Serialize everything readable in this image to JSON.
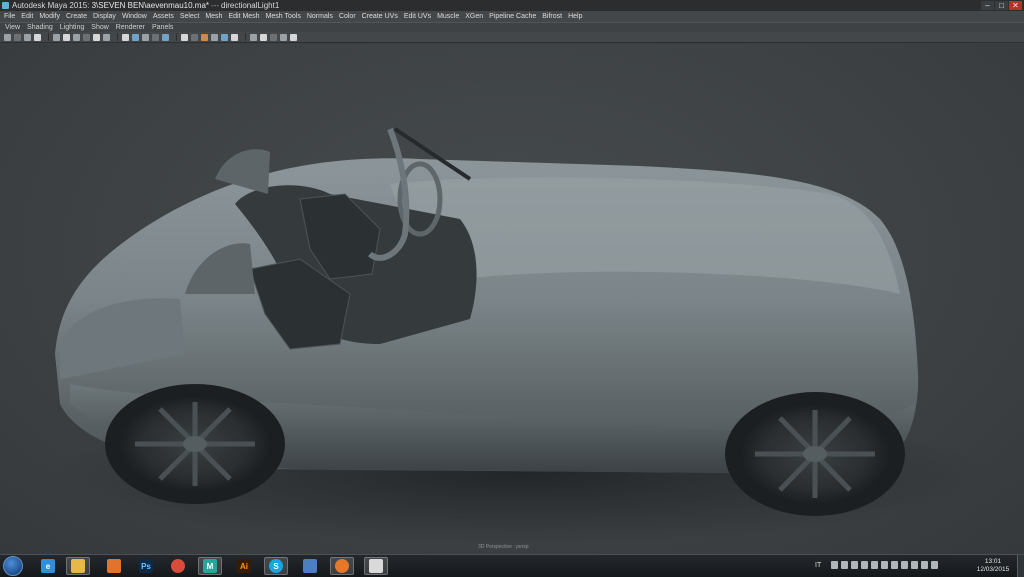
{
  "window": {
    "app_title": "Autodesk Maya 2015: ",
    "file_path": "3\\SEVEN BEN\\aevenmau10.ma*",
    "separator": "---",
    "selection": "directionalLight1",
    "controls": [
      "–",
      "□",
      "✕"
    ]
  },
  "menu": [
    "File",
    "Edit",
    "Modify",
    "Create",
    "Display",
    "Window",
    "Assets",
    "Select",
    "Mesh",
    "Edit Mesh",
    "Mesh Tools",
    "Normals",
    "Color",
    "Create UVs",
    "Edit UVs",
    "Muscle",
    "XGen",
    "Pipeline Cache",
    "Bifrost",
    "Help"
  ],
  "panel_menu": [
    "View",
    "Shading",
    "Lighting",
    "Show",
    "Renderer",
    "Panels"
  ],
  "toolbar_icons": [
    "camera-select-icon",
    "camera-lock-icon",
    "bookmark-icon",
    "image-plane-icon",
    "grid-icon",
    "film-gate-icon",
    "resolution-gate-icon",
    "gate-mask-icon",
    "field-chart-icon",
    "safe-action-icon",
    "wireframe-icon",
    "smooth-shade-icon",
    "flat-shade-icon",
    "bounding-box-icon",
    "textured-icon",
    "lights-icon",
    "shadows-icon",
    "ambient-occlusion-icon",
    "motion-blur-icon",
    "anti-alias-icon",
    "depth-of-field-icon",
    "isolate-select-icon",
    "xray-icon",
    "xray-joints-icon",
    "backface-icon",
    "gamma-icon"
  ],
  "viewport": {
    "camera_label": "3D Perspective : persp",
    "background": "#3d4143"
  },
  "taskbar": {
    "apps": [
      {
        "name": "ie",
        "glyph": "e",
        "color": "#2f8fdb"
      },
      {
        "name": "explorer",
        "glyph": "",
        "color": "#e5b948"
      },
      {
        "name": "pizza",
        "glyph": "",
        "color": "#e0742c"
      },
      {
        "name": "photoshop",
        "glyph": "Ps",
        "color": "#0e2a47"
      },
      {
        "name": "chrome",
        "glyph": "",
        "color": "#d94b3b"
      },
      {
        "name": "maya",
        "glyph": "M",
        "color": "#2aa59a"
      },
      {
        "name": "illustrator",
        "glyph": "Ai",
        "color": "#3b1b00"
      },
      {
        "name": "skype",
        "glyph": "S",
        "color": "#17a5e6"
      },
      {
        "name": "display",
        "glyph": "",
        "color": "#4d7fbf"
      },
      {
        "name": "firefox",
        "glyph": "",
        "color": "#e6782a"
      },
      {
        "name": "app",
        "glyph": "",
        "color": "#d9d9d9"
      }
    ],
    "lang": "IT",
    "time": "13:01",
    "date": "12/03/2015"
  }
}
